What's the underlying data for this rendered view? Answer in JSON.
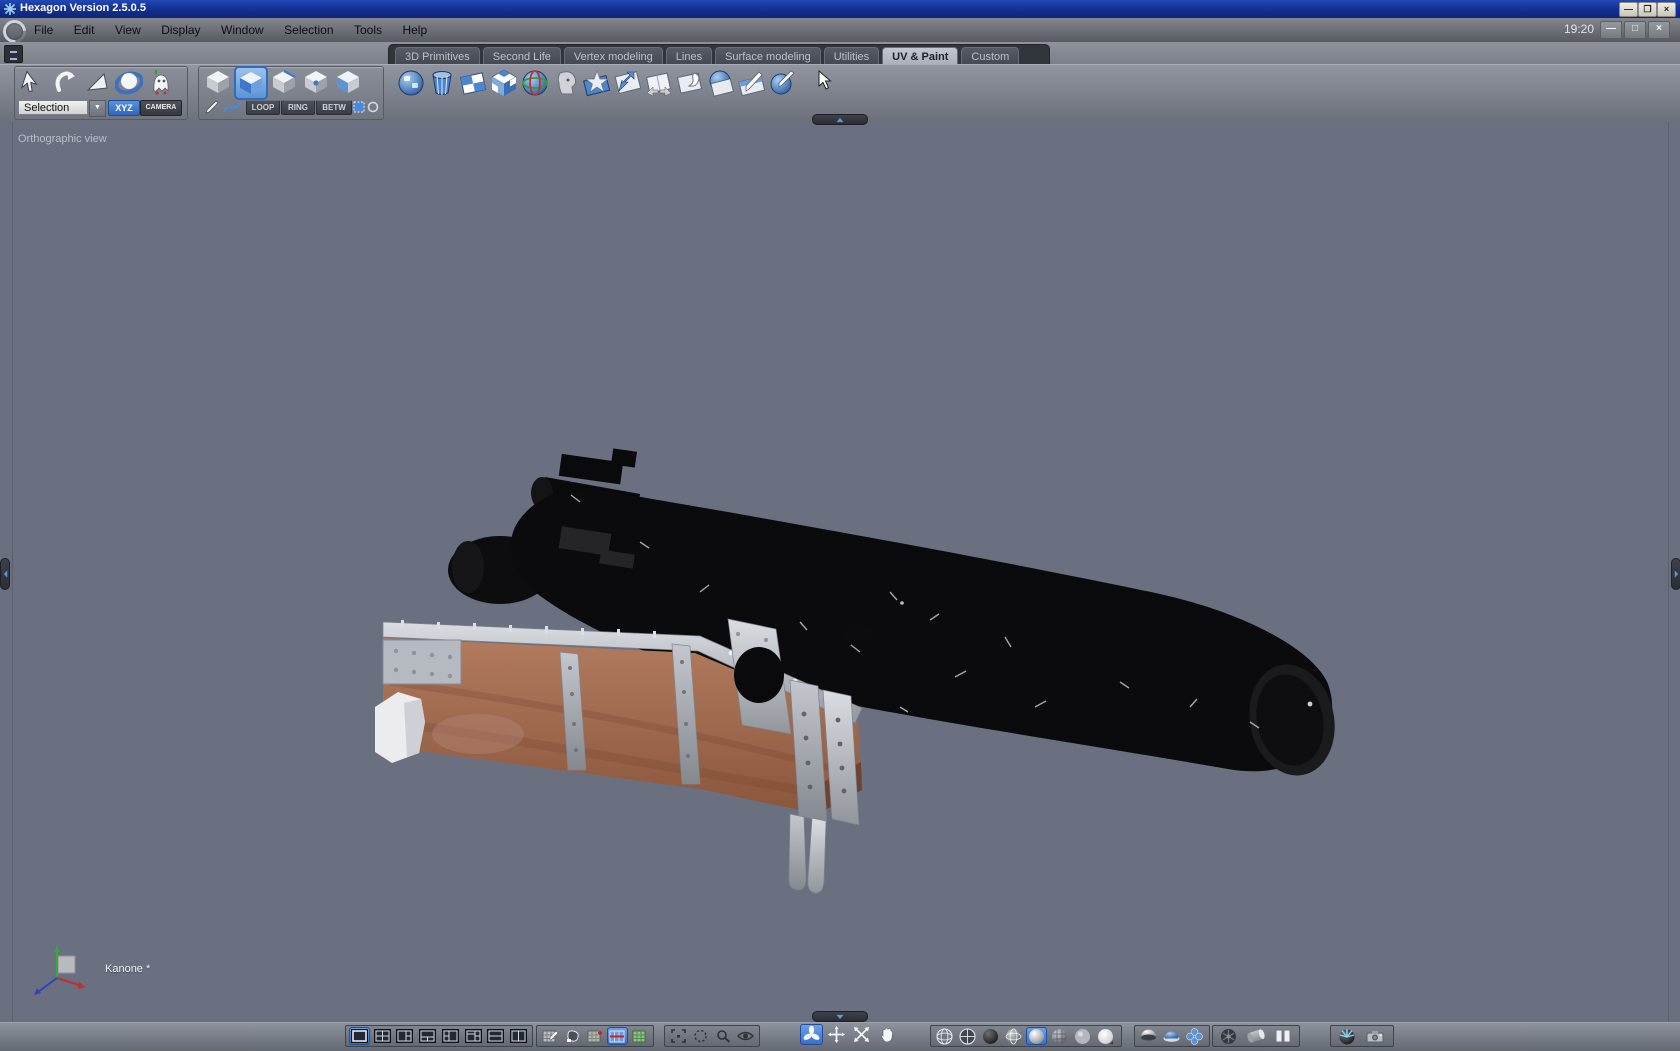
{
  "window": {
    "title": "Hexagon Version 2.5.0.5",
    "time": "19:20",
    "title_controls": [
      "minimize",
      "restore",
      "close"
    ],
    "menu_controls": [
      "minimize",
      "maximize",
      "close"
    ]
  },
  "menu": {
    "items": [
      "File",
      "Edit",
      "View",
      "Display",
      "Window",
      "Selection",
      "Tools",
      "Help"
    ]
  },
  "tabs": {
    "items": [
      "3D Primitives",
      "Second Life",
      "Vertex modeling",
      "Lines",
      "Surface modeling",
      "Utilities",
      "UV & Paint",
      "Custom"
    ],
    "active": "UV & Paint"
  },
  "selection_panel": {
    "icons": [
      "select-arrow",
      "rotate-select",
      "cone-select",
      "ring-sphere",
      "ghost-select"
    ],
    "dropdown_value": "Selection",
    "xyz_label": "XYZ",
    "camera_label": "CAMERA"
  },
  "mode_panel": {
    "icons": [
      "select-object-cube",
      "select-face-cube",
      "select-edge-cube",
      "select-vertex-cube",
      "select-all-cube",
      "pen",
      "curve",
      "snap-grid",
      "soft-select"
    ],
    "selected_icon": "select-face-cube",
    "loop_label": "LOOP",
    "ring_label": "RING",
    "betw_label": "BETW"
  },
  "uv_toolbar": {
    "icons": [
      "uv-sphere",
      "uv-cylinder",
      "uv-plane-checker",
      "uv-box-checker",
      "uv-globe-projection",
      "uv-head",
      "uv-star-plane",
      "uv-arrow-plane",
      "uv-unfold-plane",
      "uv-peel-plane",
      "uv-sphere-plane",
      "uv-brush-plane",
      "uv-paint-sphere"
    ]
  },
  "viewport": {
    "view_label": "Orthographic view",
    "object_label": "Kanone *",
    "background_color": "#6a7080",
    "axis_colors": {
      "x": "#c03030",
      "y": "#2fae2f",
      "z": "#3040c0"
    }
  },
  "bottom_toolbar": {
    "layout_group": [
      "layout-single",
      "layout-quad",
      "layout-quad-left",
      "layout-three-top",
      "layout-split-left",
      "layout-split-right",
      "layout-two-rows",
      "layout-two-columns"
    ],
    "layout_selected": "layout-single",
    "paint_group": [
      "uvmap-edit",
      "paint-object",
      "grid-add",
      "grid-active",
      "grid-view"
    ],
    "view_group": [
      "fit-view",
      "pan-view",
      "zoom-view",
      "visibility"
    ],
    "nav_group": [
      "rotate-view",
      "move-view",
      "dolly-view",
      "grab-view"
    ],
    "nav_selected": "rotate-view",
    "shading_group": [
      "wireframe",
      "hidden-line",
      "flat-dark",
      "shaded-wire",
      "smooth",
      "textured",
      "matte",
      "bright"
    ],
    "shading_selected": "smooth",
    "subdiv_group": [
      "half-sphere",
      "dome",
      "flower"
    ],
    "media_group": [
      "wheel",
      "cylinder",
      "panels"
    ],
    "render_group": [
      "render-sphere",
      "camera"
    ]
  },
  "colors": {
    "titlebar": "#16329c",
    "accent_blue": "#3f7ad6",
    "toolbar_gray": "#7d828c",
    "tab_active": "#b6bbc4"
  }
}
